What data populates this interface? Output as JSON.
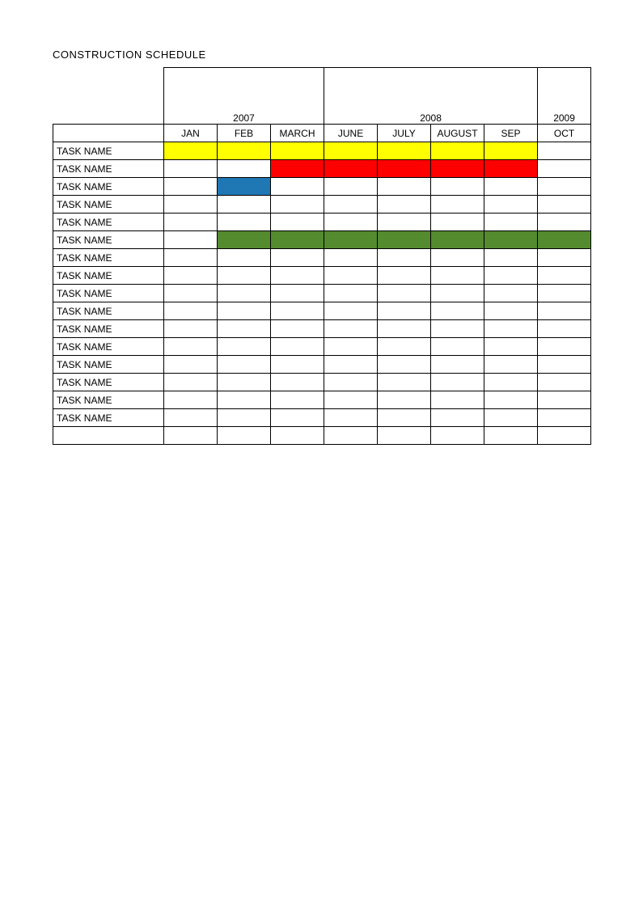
{
  "title": "CONSTRUCTION SCHEDULE",
  "years": [
    "2007",
    "2008",
    "2009"
  ],
  "months": [
    "JAN",
    "FEB",
    "MARCH",
    "JUNE",
    "JULY",
    "AUGUST",
    "SEP",
    "OCT"
  ],
  "tasks": [
    "TASK NAME",
    "TASK NAME",
    "TASK NAME",
    "TASK NAME",
    "TASK NAME",
    "TASK NAME",
    "TASK NAME",
    "TASK NAME",
    "TASK NAME",
    "TASK NAME",
    "TASK NAME",
    "TASK NAME",
    "TASK NAME",
    "TASK NAME",
    "TASK NAME",
    "TASK NAME"
  ],
  "chart_data": {
    "type": "gantt",
    "title": "CONSTRUCTION SCHEDULE",
    "columns": [
      "JAN",
      "FEB",
      "MARCH",
      "JUNE",
      "JULY",
      "AUGUST",
      "SEP",
      "OCT"
    ],
    "year_groups": [
      {
        "year": "2007",
        "span": 3
      },
      {
        "year": "2008",
        "span": 4
      },
      {
        "year": "2009",
        "span": 1
      }
    ],
    "bars": [
      {
        "row": 0,
        "start": 0,
        "end": 6,
        "color": "yellow"
      },
      {
        "row": 1,
        "start": 2,
        "end": 6,
        "color": "red"
      },
      {
        "row": 2,
        "start": 1,
        "end": 1,
        "color": "blue"
      },
      {
        "row": 5,
        "start": 1,
        "end": 7,
        "color": "green"
      }
    ],
    "row_count": 16
  },
  "colors": {
    "yellow": "#FFFF00",
    "red": "#FF0000",
    "blue": "#1F77B4",
    "green": "#558B2F"
  }
}
